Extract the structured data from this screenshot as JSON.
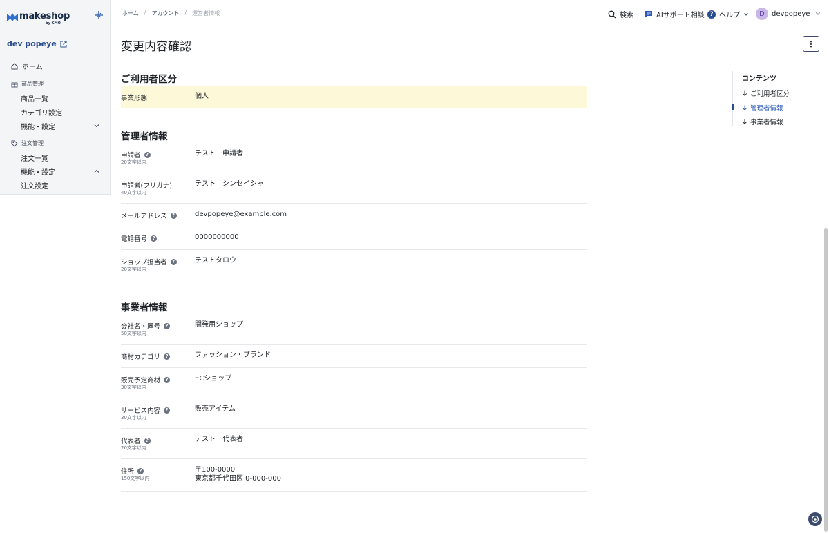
{
  "app": {
    "logo_text": "makeshop",
    "logo_sub": "by GMO",
    "shop_name": "dev popeye"
  },
  "sidebar": {
    "home": "ホーム",
    "sections": [
      {
        "title": "商品管理",
        "items": [
          "商品一覧",
          "カテゴリ設定",
          "機能・設定"
        ]
      },
      {
        "title": "注文管理",
        "items": [
          "注文一覧",
          "機能・設定",
          "注文設定"
        ]
      }
    ]
  },
  "header": {
    "breadcrumb": [
      "ホーム",
      "アカウント",
      "運営者情報"
    ],
    "search": "検索",
    "ai_support": "AIサポート相談",
    "help": "ヘルプ",
    "user_initial": "D",
    "user_name": "devpopeye"
  },
  "main": {
    "title": "変更内容確認",
    "sections": [
      {
        "title": "ご利用者区分",
        "rows": [
          {
            "label": "事業形態",
            "value": "個人"
          }
        ]
      },
      {
        "title": "管理者情報",
        "rows": [
          {
            "label": "申請者",
            "sub": "20文字以内",
            "value": "テスト　申請者"
          },
          {
            "label": "申請者(フリガナ)",
            "sub": "40文字以内",
            "value": "テスト　シンセイシャ"
          },
          {
            "label": "メールアドレス",
            "value": "devpopeye@example.com"
          },
          {
            "label": "電話番号",
            "value": "0000000000"
          },
          {
            "label": "ショップ担当者",
            "sub": "20文字以内",
            "value": "テストタロウ"
          }
        ]
      },
      {
        "title": "事業者情報",
        "rows": [
          {
            "label": "会社名・屋号",
            "sub": "50文字以内",
            "value": "開発用ショップ"
          },
          {
            "label": "商材カテゴリ",
            "value": "ファッション・ブランド"
          },
          {
            "label": "販売予定商材",
            "sub": "30文字以内",
            "value": "ECショップ"
          },
          {
            "label": "サービス内容",
            "sub": "30文字以内",
            "value": "販売アイテム"
          },
          {
            "label": "代表者",
            "sub": "20文字以内",
            "value": "テスト　代表者"
          },
          {
            "label": "住所",
            "sub": "150文字以内",
            "value": "〒100-0000",
            "value2": "東京都千代田区 0-000-000"
          }
        ]
      }
    ]
  },
  "toc": {
    "title": "コンテンツ",
    "items": [
      "ご利用者区分",
      "管理者情報",
      "事業者情報"
    ],
    "active_index": 1
  },
  "colors": {
    "accent": "#2f5bb7",
    "highlight": "#fdf8d8",
    "brand": "#1a2b45"
  }
}
